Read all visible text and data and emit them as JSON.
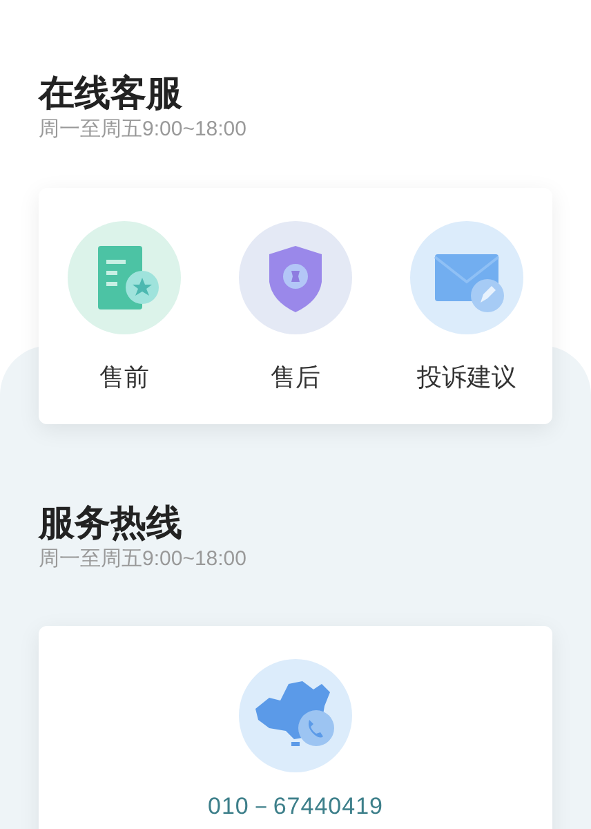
{
  "online_service": {
    "title": "在线客服",
    "hours": "周一至周五9:00~18:00",
    "items": [
      {
        "label": "售前"
      },
      {
        "label": "售后"
      },
      {
        "label": "投诉建议"
      }
    ]
  },
  "hotline": {
    "title": "服务热线",
    "hours": "周一至周五9:00~18:00",
    "phone": "010－67440419"
  }
}
